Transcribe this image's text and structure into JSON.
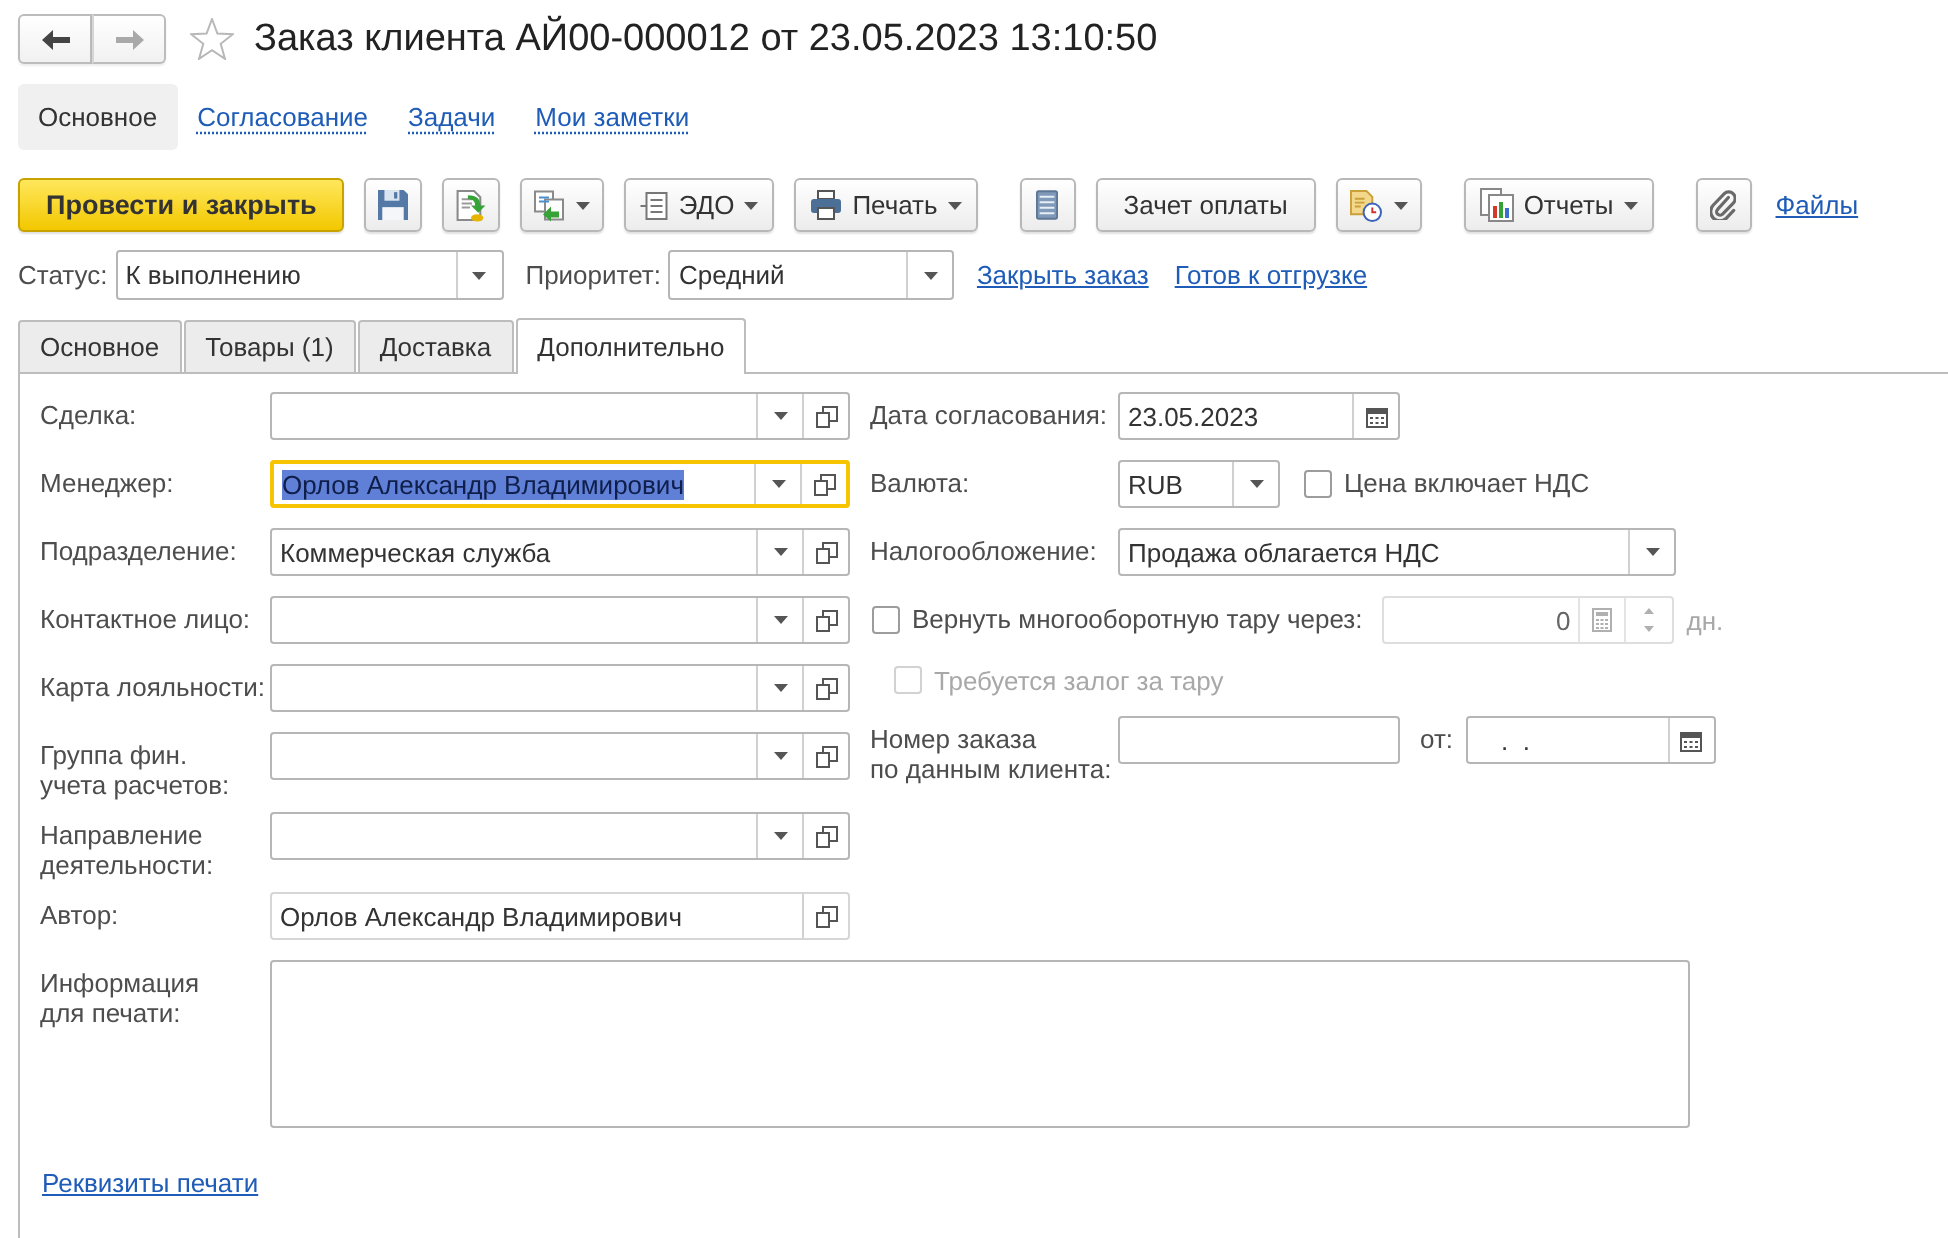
{
  "window": {
    "title": "Заказ клиента АЙ00-000012 от 23.05.2023 13:10:50"
  },
  "history": {
    "back_enabled": true,
    "forward_enabled": false
  },
  "favorite": false,
  "nav_tabs": [
    {
      "label": "Основное",
      "selected": true
    },
    {
      "label": "Согласование",
      "selected": false
    },
    {
      "label": "Задачи",
      "selected": false
    },
    {
      "label": "Мои заметки",
      "selected": false
    }
  ],
  "toolbar": [
    [
      {
        "kind": "primary",
        "label": "Провести и закрыть",
        "dropdown": false
      },
      {
        "kind": "icon",
        "dropdown": false
      },
      {
        "kind": "icon",
        "dropdown": false
      },
      {
        "kind": "icon",
        "dropdown": true
      },
      {
        "kind": "icon_text",
        "label": "ЭДО",
        "dropdown": true
      },
      {
        "kind": "icon_text",
        "label": "Печать",
        "dropdown": true
      }
    ],
    [
      {
        "kind": "icon",
        "dropdown": false
      },
      {
        "kind": "text",
        "label": "Зачет оплаты",
        "dropdown": false
      },
      {
        "kind": "icon",
        "dropdown": true
      }
    ],
    [
      {
        "kind": "icon_text",
        "label": "Отчеты",
        "dropdown": true
      }
    ],
    [
      {
        "kind": "icon",
        "dropdown": false
      },
      {
        "kind": "link",
        "label": "Файлы"
      }
    ]
  ],
  "header_fields": [
    {
      "label": "Статус:",
      "value": "К выполнению"
    },
    {
      "label": "Приоритет:",
      "value": "Средний"
    }
  ],
  "header_links": [
    "Закрыть заказ",
    "Готов к отгрузке"
  ],
  "form_tabs": [
    {
      "label": "Основное",
      "selected": false
    },
    {
      "label": "Товары (1)",
      "selected": false
    },
    {
      "label": "Доставка",
      "selected": false
    },
    {
      "label": "Дополнительно",
      "selected": true
    }
  ],
  "left_fields": [
    {
      "kind": "select",
      "label": "Сделка:",
      "focused": false
    },
    {
      "kind": "select",
      "label": "Менеджер:",
      "value": "Орлов Александр Владимирович",
      "focused": true
    },
    {
      "kind": "select",
      "label": "Подразделение:",
      "value": "Коммерческая служба",
      "focused": false
    },
    {
      "kind": "select",
      "label": "Контактное лицо:",
      "focused": false
    },
    {
      "kind": "select",
      "label": "Карта лояльности:",
      "focused": false
    },
    {
      "kind": "select",
      "label": "Группа фин.\nучета расчетов:",
      "focused": false
    },
    {
      "kind": "select",
      "label": "Направление\nдеятельности:",
      "focused": false
    },
    {
      "kind": "reference",
      "label": "Автор:",
      "value": "Орлов Александр Владимирович",
      "focused": false
    }
  ],
  "right_fields": [
    {
      "kind": "date",
      "label": "Дата согласования:",
      "value": "23.05.2023",
      "disabled": false
    },
    {
      "kind": "select",
      "label": "Валюта:",
      "value": "RUB",
      "disabled": false,
      "checkbox": {
        "label": "Цена включает НДС",
        "checked": false
      }
    },
    {
      "kind": "select",
      "label": "Налогообложение:",
      "value": "Продажа облагается НДС",
      "disabled": false
    },
    {
      "kind": "check_period",
      "label": "Вернуть многооборотную тару через:",
      "checked": false,
      "value": "0",
      "unit": "дн.",
      "disabled": true
    },
    {
      "kind": "check",
      "label": "Требуется залог за тару",
      "checked": false,
      "disabled": true
    },
    {
      "kind": "text_date",
      "label": "Номер заказа\nпо данным клиента:",
      "date_label": "от:",
      "date_value": ".  .",
      "disabled": false
    }
  ],
  "memo": {
    "label": "Информация\nдля печати:"
  },
  "print_link": "Реквизиты печати"
}
